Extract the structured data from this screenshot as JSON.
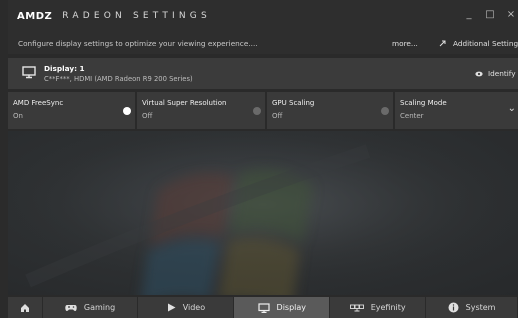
{
  "header": {
    "brand_logo": "AMDZ",
    "brand_name": "RADEON SETTINGS",
    "minimize": "_",
    "maximize": "□",
    "close": "×"
  },
  "subheader": {
    "description": "Configure display settings to optimize your viewing experience....",
    "more": "more...",
    "additional_settings": "Additional Settings"
  },
  "display": {
    "title": "Display: 1",
    "subtitle": "C**F***, HDMI (AMD Radeon R9 200 Series)",
    "identify": "Identify"
  },
  "tiles": [
    {
      "label": "AMD FreeSync",
      "value": "On"
    },
    {
      "label": "Virtual Super Resolution",
      "value": "Off"
    },
    {
      "label": "GPU Scaling",
      "value": "Off"
    },
    {
      "label": "Scaling Mode",
      "value": "Center"
    }
  ],
  "nav": {
    "gaming": "Gaming",
    "video": "Video",
    "display": "Display",
    "eyefinity": "Eyefinity",
    "system": "System"
  },
  "colors": {
    "accent_on": "#ffffff",
    "background": "#2a2a2a"
  }
}
